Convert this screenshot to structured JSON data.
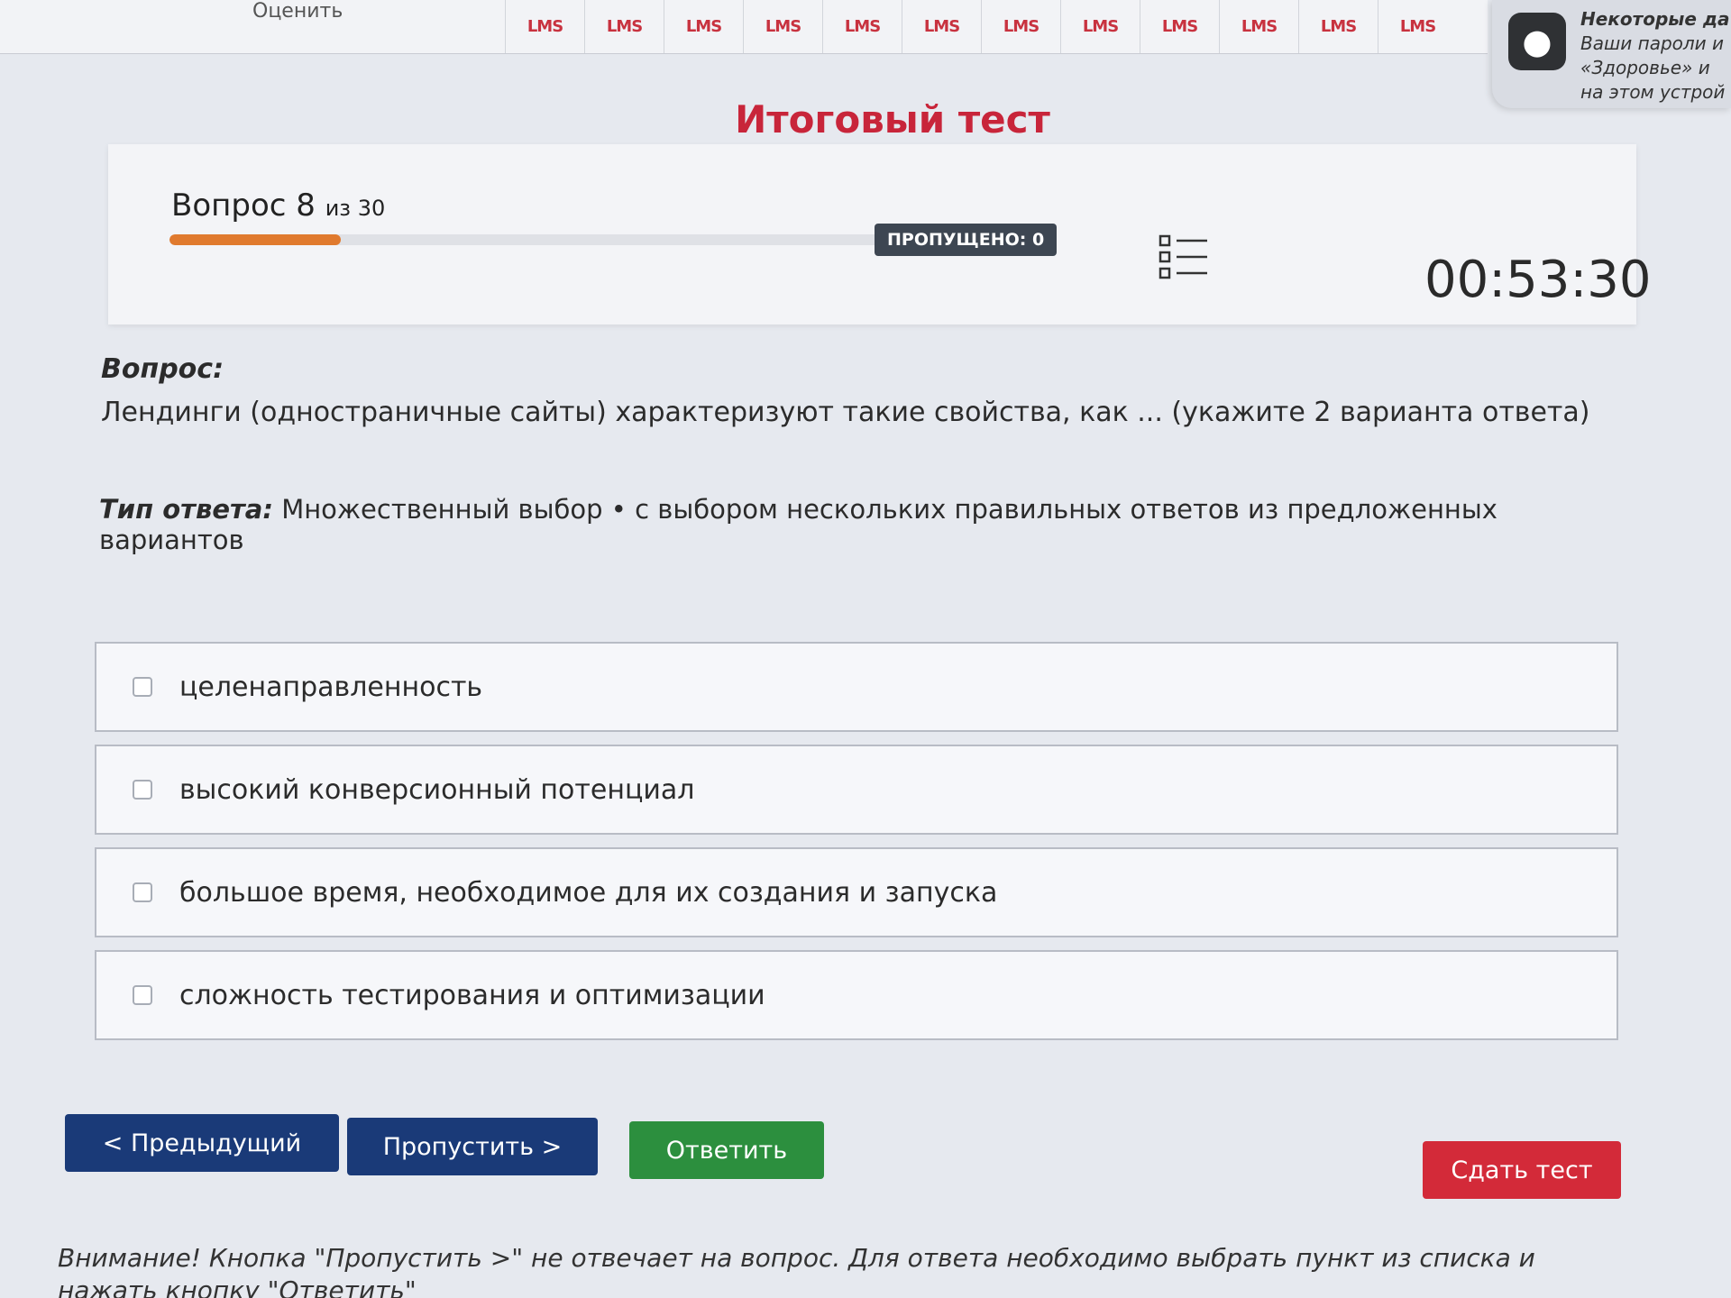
{
  "top_tabs": {
    "lead_label": "Оценить",
    "items": [
      "LMS",
      "LMS",
      "LMS",
      "LMS",
      "LMS",
      "LMS",
      "LMS",
      "LMS",
      "LMS",
      "LMS",
      "LMS",
      "LMS"
    ]
  },
  "notification": {
    "title": "Некоторые да",
    "lines": [
      "Ваши пароли и",
      "«Здоровье» и",
      "на этом устрой"
    ]
  },
  "page": {
    "title": "Итоговый тест"
  },
  "progress": {
    "question_prefix": "Вопрос",
    "current": "8",
    "of_label": "из 30",
    "fraction": 0.2,
    "skipped_badge": "ПРОПУЩЕНО: 0",
    "timer": "00:53:30"
  },
  "question": {
    "label": "Вопрос:",
    "text": "Лендинги (одностраничные сайты) характеризуют такие свойства, как ... (укажите 2 варианта ответа)",
    "answer_type_label": "Тип ответа:",
    "answer_type_value": "Множественный выбор • с выбором нескольких правильных ответов из предложенных вариантов"
  },
  "options": [
    {
      "label": "целенаправленность"
    },
    {
      "label": "высокий конверсионный потенциал"
    },
    {
      "label": "большое время, необходимое для их создания и запуска"
    },
    {
      "label": "сложность тестирования и оптимизации"
    }
  ],
  "buttons": {
    "prev": "< Предыдущий",
    "skip": "Пропустить >",
    "answer": "Ответить",
    "submit": "Сдать тест"
  },
  "warning": "Внимание! Кнопка \"Пропустить >\" не отвечает на вопрос. Для ответа необходимо выбрать пункт из списка и нажать кнопку \"Ответить\""
}
